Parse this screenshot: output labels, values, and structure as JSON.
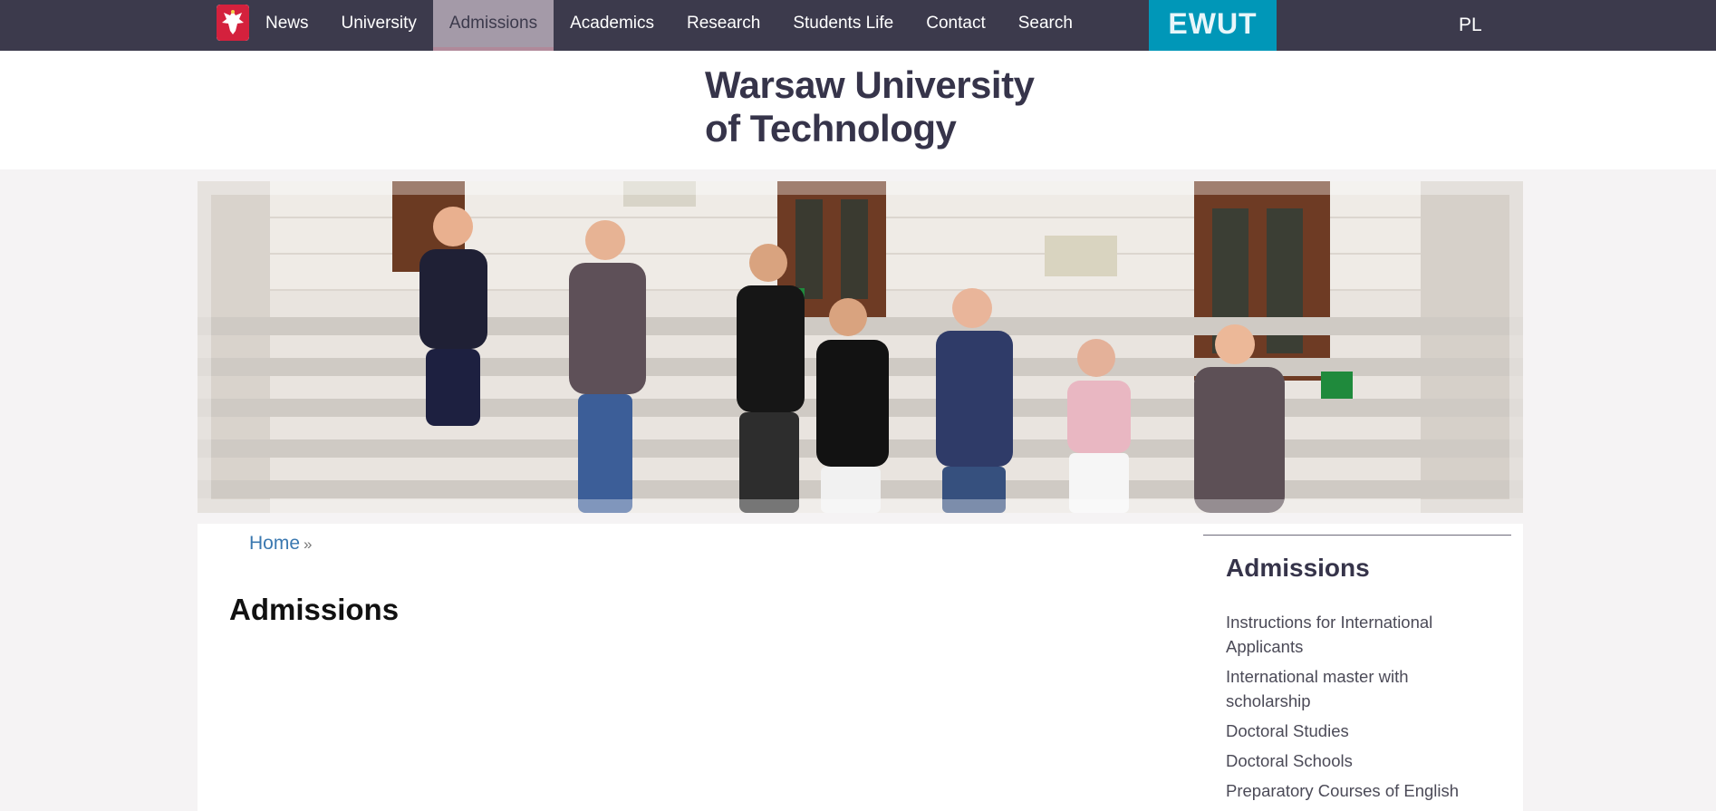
{
  "nav": {
    "items": [
      "News",
      "University",
      "Admissions",
      "Academics",
      "Research",
      "Students Life",
      "Contact",
      "Search"
    ],
    "active": "Admissions",
    "ewut_logo": "EWUT",
    "language": "PL"
  },
  "header": {
    "brand_line1": "Warsaw University",
    "brand_line2": "of Technology"
  },
  "breadcrumb": {
    "home": "Home",
    "separator": "»"
  },
  "main": {
    "title": "Admissions"
  },
  "sidebar": {
    "heading": "Admissions",
    "links": [
      "Instructions for International Applicants",
      "International master with scholarship",
      "Doctoral Studies",
      "Doctoral Schools",
      "Preparatory Courses of English"
    ]
  },
  "colors": {
    "nav_bg": "#3c3a4c",
    "active_bg": "#a49aa8",
    "ewut_bg": "#0097b8",
    "link": "#3a78b0"
  }
}
